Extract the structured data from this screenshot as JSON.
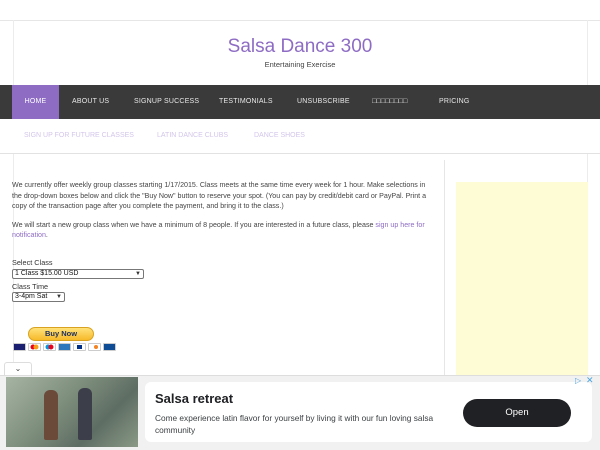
{
  "site": {
    "title": "Salsa Dance 300",
    "tagline": "Entertaining Exercise"
  },
  "nav": {
    "items": [
      {
        "label": "HOME",
        "active": true
      },
      {
        "label": "ABOUT US"
      },
      {
        "label": "SIGNUP SUCCESS"
      },
      {
        "label": "TESTIMONIALS"
      },
      {
        "label": "UNSUBSCRIBE"
      },
      {
        "label": "□□□□□□□□"
      },
      {
        "label": "PRICING"
      }
    ],
    "sub_items": [
      {
        "label": "SIGN UP FOR FUTURE CLASSES"
      },
      {
        "label": "LATIN DANCE CLUBS"
      },
      {
        "label": "DANCE SHOES"
      }
    ]
  },
  "content": {
    "paragraph1": "We currently offer weekly group classes starting 1/17/2015. Class meets at the same time every week for 1 hour. Make selections in the drop-down boxes below and click the \"Buy Now\" button to reserve your spot. (You can pay by credit/debit card or PayPal. Print a copy of the transaction page after you complete the payment, and bring it to the class.)",
    "paragraph2_start": "We will start a new group class when we have a minimum of 8 people. If you are interested in a future class, please ",
    "paragraph2_link": "sign up here for notification",
    "paragraph2_end": ".",
    "select_class_label": "Select Class",
    "select_class_value": "1 Class $15.00 USD",
    "class_time_label": "Class Time",
    "class_time_value": "3-4pm Sat",
    "buy_now_label": "Buy Now",
    "card_icons": [
      "visa-icon",
      "mastercard-icon",
      "maestro-icon",
      "amex-icon",
      "paypal-icon",
      "discover-icon",
      "card-icon"
    ]
  },
  "ad": {
    "title": "Salsa retreat",
    "body": "Come experience latin flavor for yourself by living it with our fun loving salsa community",
    "cta": "Open",
    "collapse_icon": "chevron-down-icon"
  },
  "colors": {
    "accent": "#8e6cc4",
    "nav_bg": "#3a3a3a",
    "ad_placeholder": "#fefcd4"
  }
}
